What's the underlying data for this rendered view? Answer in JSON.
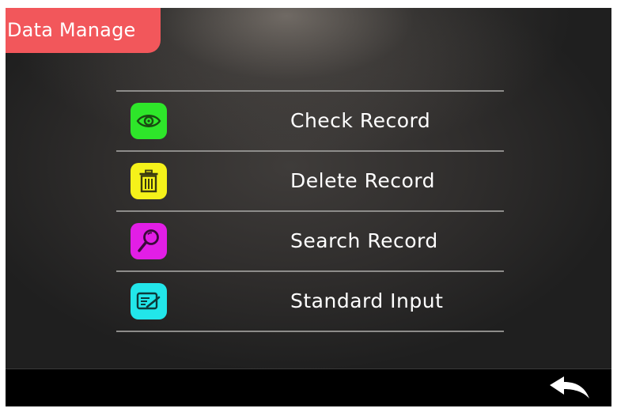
{
  "header": {
    "title": "Data Manage"
  },
  "menu": {
    "items": [
      {
        "label": "Check Record",
        "icon": "eye-icon",
        "color": "#2ee62a"
      },
      {
        "label": "Delete Record",
        "icon": "trash-icon",
        "color": "#f5f21a"
      },
      {
        "label": "Search Record",
        "icon": "magnifier-icon",
        "color": "#e21ee6"
      },
      {
        "label": "Standard Input",
        "icon": "edit-card-icon",
        "color": "#22e6ea"
      }
    ]
  },
  "footer": {
    "back_icon": "back-arrow-icon"
  },
  "colors": {
    "title_tab": "#f2575b",
    "background": "#2f2d2c",
    "bottom_bar": "#000000",
    "divider": "#8d8c8a",
    "text": "#ffffff"
  }
}
